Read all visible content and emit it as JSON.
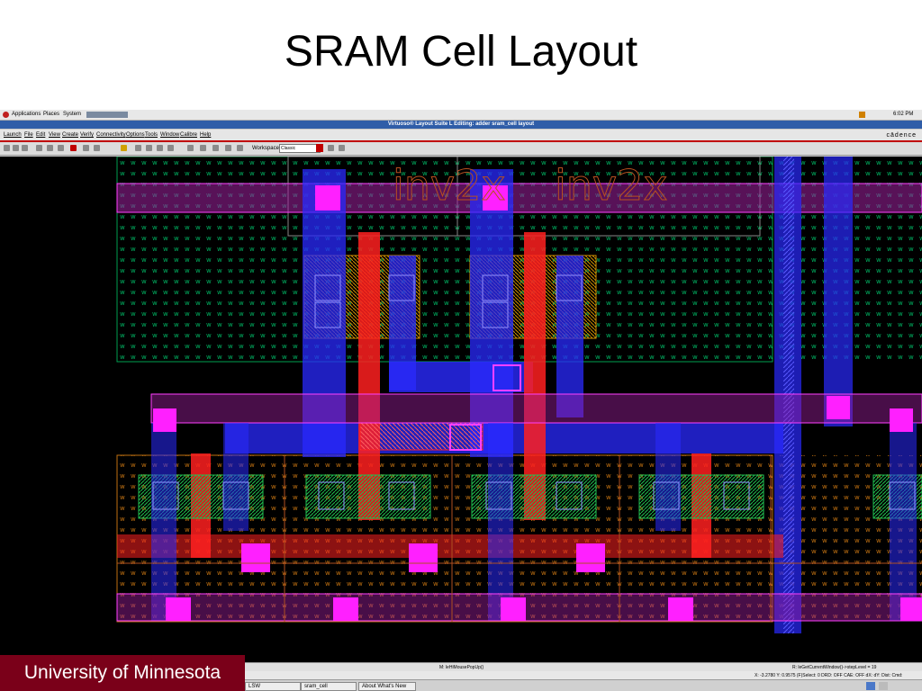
{
  "slide": {
    "title": "SRAM Cell Layout",
    "footer": "University of Minnesota"
  },
  "panel": {
    "items": [
      "Applications",
      "Places",
      "System"
    ],
    "clock": "6:02 PM"
  },
  "window": {
    "title": "Virtuoso® Layout Suite L Editing: adder sram_cell layout"
  },
  "menu": {
    "items": [
      "Launch",
      "File",
      "Edit",
      "View",
      "Create",
      "Verify",
      "Connectivity",
      "Options",
      "Tools",
      "Window",
      "Calibre",
      "Help"
    ],
    "brand": "cādence"
  },
  "toolbar": {
    "workspace_label": "Workspace:",
    "workspace_value": "Classic"
  },
  "layout": {
    "labels": [
      "inv2x",
      "inv2x"
    ],
    "colors": {
      "background": "#000000",
      "metal1": "#2a2aff",
      "poly": "#ff2020",
      "contact": "#ff00ff",
      "nwell": "#00cc44",
      "diffusion": "#cc8800",
      "label": "#b85020"
    }
  },
  "status": {
    "left": "M: leHiMousePopUp()",
    "right": "R: leGetCurrentWindow()->stepLevel = 19",
    "coords": "X: -3.2780   Y: 0.9575   (F)Select: 0   DRD: OFF   CAE: OFF   dX:  dY:  Dist: Cmd:"
  },
  "taskbar": {
    "items": [
      "LSW",
      "sram_cell",
      "About What's New"
    ]
  }
}
